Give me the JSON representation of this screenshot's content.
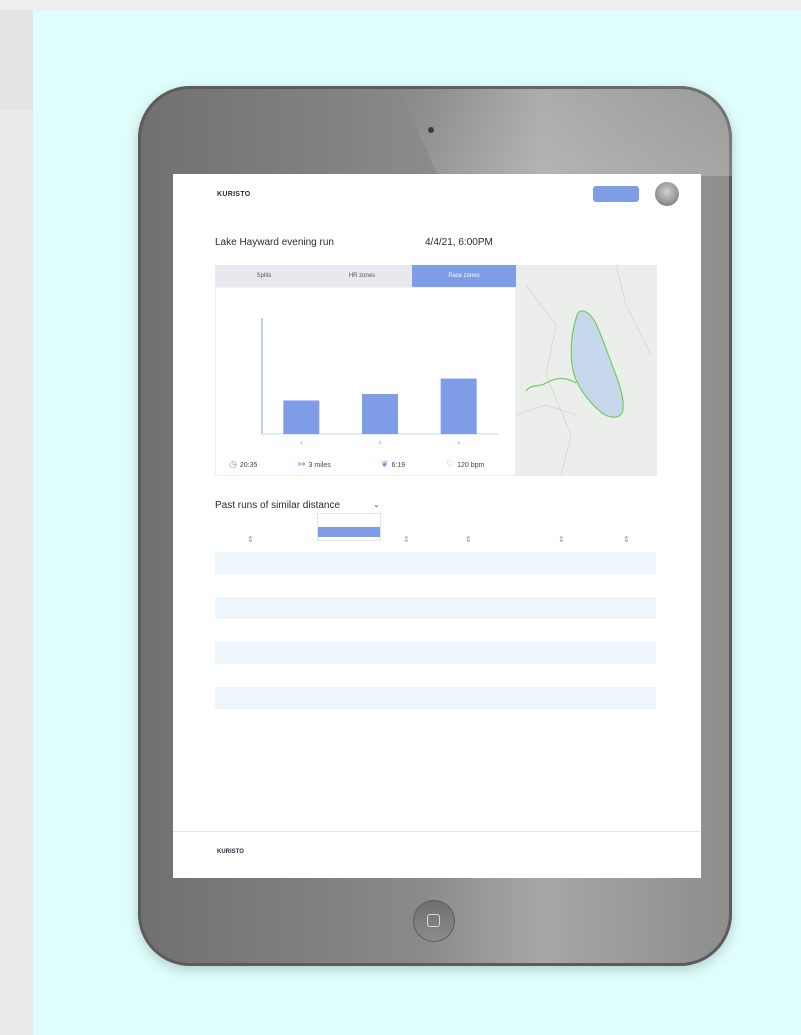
{
  "app": {
    "brand": "KURISTO",
    "nav": [
      {
        "label": "",
        "active": false
      },
      {
        "label": "",
        "active": true
      },
      {
        "label": "",
        "active": false
      },
      {
        "label": "",
        "active": false
      }
    ],
    "search_placeholder": "",
    "login_label": ""
  },
  "run": {
    "title": "Lake Hayward evening run",
    "datetime": "4/4/21, 6:00PM"
  },
  "tabs": [
    {
      "label": "Splits",
      "active": false
    },
    {
      "label": "HR zones",
      "active": false
    },
    {
      "label": "Pace zones",
      "active": true
    }
  ],
  "chart_data": {
    "type": "bar",
    "categories": [
      "1",
      "2",
      "3"
    ],
    "values": [
      1.3,
      1.55,
      2.15
    ],
    "ylim": [
      0,
      4.5
    ],
    "color": "#7f9ce6"
  },
  "stats": {
    "time": "20:35",
    "distance": "3 miles",
    "pace": "6:19",
    "heart_rate": "120 bpm"
  },
  "past_runs": {
    "title": "Past runs of similar distance",
    "view_all": "",
    "dropdown_options": [
      {
        "label": "",
        "selected": false
      },
      {
        "label": "",
        "selected": true
      }
    ],
    "columns": [
      "",
      "",
      "",
      "",
      ""
    ],
    "rows": [
      [
        "",
        "",
        "",
        "",
        ""
      ],
      [
        "",
        "",
        "",
        "",
        ""
      ],
      [
        "",
        "",
        "",
        "",
        ""
      ],
      [
        "",
        "",
        "",
        "",
        ""
      ],
      [
        "",
        "",
        "",
        "",
        ""
      ],
      [
        "",
        "",
        "",
        "",
        ""
      ],
      [
        "",
        "",
        "",
        "",
        ""
      ],
      [
        "",
        "",
        "",
        "",
        ""
      ]
    ]
  },
  "footer": {
    "brand": "KURISTO",
    "copyright": "",
    "links": [
      "",
      "",
      ""
    ]
  },
  "colors": {
    "accent": "#7f9ce6",
    "background": "#dffdfb",
    "route": "#6ccf5a",
    "lake": "#c8d8ec"
  }
}
